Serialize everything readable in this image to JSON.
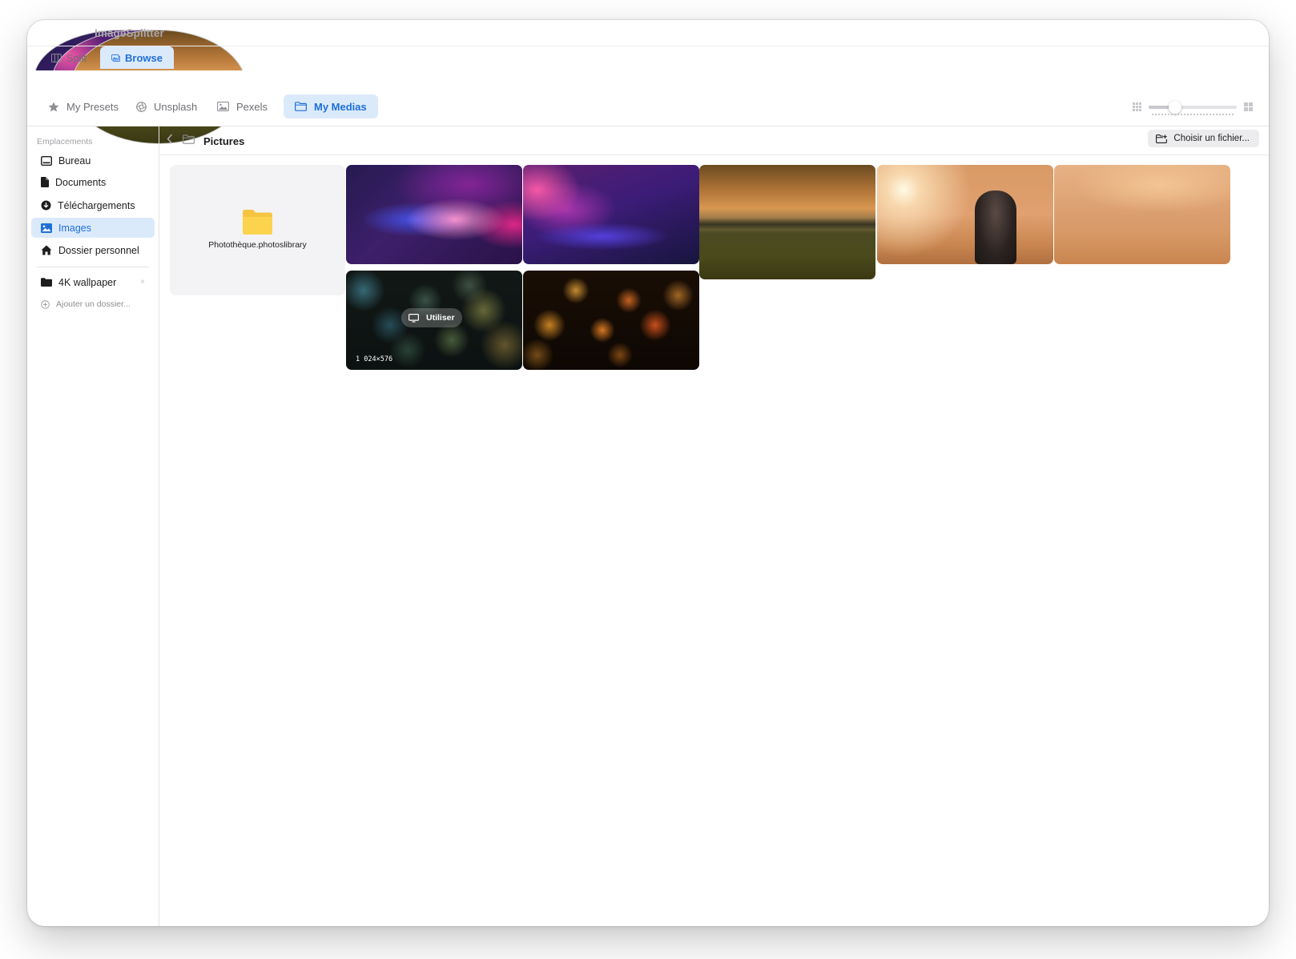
{
  "app": {
    "title": "ImageSplitter"
  },
  "main_tabs": [
    {
      "label": "Split",
      "icon": "split-columns-icon"
    },
    {
      "label": "Browse",
      "icon": "browse-photos-icon",
      "active": true
    }
  ],
  "source_tabs": [
    {
      "label": "My Presets",
      "icon": "star-icon"
    },
    {
      "label": "Unsplash",
      "icon": "aperture-icon"
    },
    {
      "label": "Pexels",
      "icon": "photo-icon"
    },
    {
      "label": "My Medias",
      "icon": "folder-icon",
      "active": true
    }
  ],
  "zoom": {
    "value": 0.3,
    "min_icon": "small-grid-icon",
    "max_icon": "large-grid-icon"
  },
  "sidebar": {
    "heading": "Emplacements",
    "items": [
      {
        "label": "Bureau",
        "icon": "desktop-icon"
      },
      {
        "label": "Documents",
        "icon": "document-icon"
      },
      {
        "label": "Téléchargements",
        "icon": "download-icon"
      },
      {
        "label": "Images",
        "icon": "image-icon",
        "active": true
      },
      {
        "label": "Dossier personnel",
        "icon": "home-icon"
      }
    ],
    "custom_folders": [
      {
        "label": "4K wallpaper",
        "icon": "folder-icon",
        "remove": "×"
      }
    ],
    "add_folder_label": "Ajouter un dossier..."
  },
  "pathbar": {
    "title": "Pictures",
    "choose_file_label": "Choisir un fichier..."
  },
  "grid": {
    "folder": {
      "label": "Photothèque.photoslibrary"
    },
    "hovered": {
      "use_label": "Utiliser",
      "dimensions": "1 024×576"
    }
  },
  "colors": {
    "accent": "#1f6fd8",
    "accent_bg": "#dbeafb",
    "folder": "#f7c948"
  }
}
